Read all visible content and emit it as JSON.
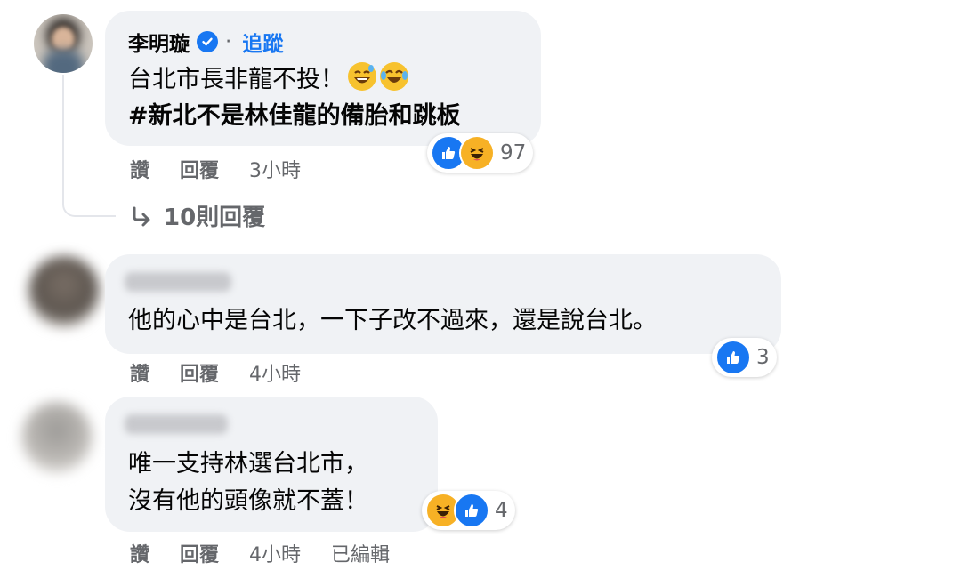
{
  "comments": [
    {
      "author": "李明璇",
      "verified": true,
      "follow_label": "追蹤",
      "text_line_1": "台北市長非龍不投！",
      "text_line_2": "#新北不是林佳龍的備胎和跳板",
      "reactions": [
        "like",
        "haha"
      ],
      "reaction_count": "97",
      "like_label": "讚",
      "reply_label": "回覆",
      "timestamp": "3小時",
      "replies_link": "10則回覆"
    },
    {
      "author_blurred": true,
      "text_line_1": "他的心中是台北，一下子改不過來，還是說台北。",
      "reactions": [
        "like"
      ],
      "reaction_count": "3",
      "like_label": "讚",
      "reply_label": "回覆",
      "timestamp": "4小時"
    },
    {
      "author_blurred": true,
      "text_line_1": "唯一支持林選台北市，",
      "text_line_2": "沒有他的頭像就不蓋！",
      "reactions": [
        "haha",
        "like"
      ],
      "reaction_count": "4",
      "like_label": "讚",
      "reply_label": "回覆",
      "timestamp": "4小時",
      "edited_label": "已編輯"
    }
  ],
  "colors": {
    "bubble": "#f0f2f5",
    "link_blue": "#1877f2",
    "secondary_text": "#65676b",
    "haha_yellow": "#f7b125"
  }
}
